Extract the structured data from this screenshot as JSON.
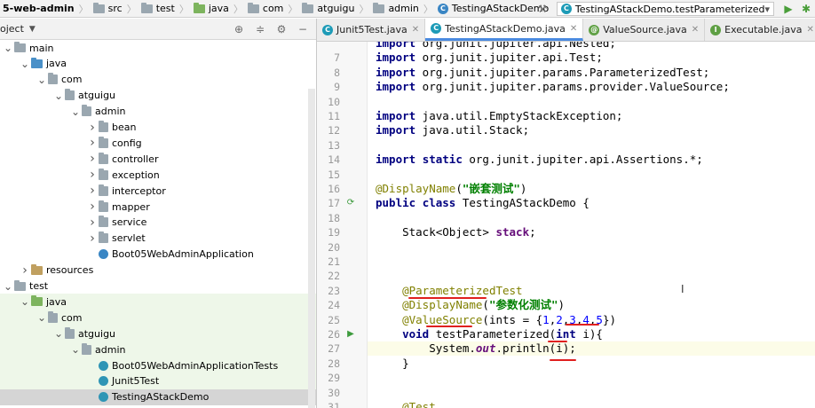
{
  "breadcrumb": {
    "items": [
      {
        "label": "5-web-admin",
        "icon": "module-icon",
        "bold": true
      },
      {
        "label": "src",
        "icon": "folder-icon"
      },
      {
        "label": "test",
        "icon": "folder-icon"
      },
      {
        "label": "java",
        "icon": "folder-icon"
      },
      {
        "label": "com",
        "icon": "package-icon"
      },
      {
        "label": "atguigu",
        "icon": "package-icon"
      },
      {
        "label": "admin",
        "icon": "package-icon"
      },
      {
        "label": "TestingAStackDemo",
        "icon": "class-icon"
      }
    ],
    "run_config": "TestingAStackDemo.testParameterized"
  },
  "project_panel": {
    "title": "oject",
    "tree": [
      {
        "label": "main",
        "indent": 0,
        "arrow": "down",
        "icon": "folder-grey"
      },
      {
        "label": "java",
        "indent": 1,
        "arrow": "down",
        "icon": "folder-blue"
      },
      {
        "label": "com",
        "indent": 2,
        "arrow": "down",
        "icon": "package-grey"
      },
      {
        "label": "atguigu",
        "indent": 3,
        "arrow": "down",
        "icon": "package-grey"
      },
      {
        "label": "admin",
        "indent": 4,
        "arrow": "down",
        "icon": "package-grey"
      },
      {
        "label": "bean",
        "indent": 5,
        "arrow": "right",
        "icon": "package-grey"
      },
      {
        "label": "config",
        "indent": 5,
        "arrow": "right",
        "icon": "package-grey"
      },
      {
        "label": "controller",
        "indent": 5,
        "arrow": "right",
        "icon": "package-grey"
      },
      {
        "label": "exception",
        "indent": 5,
        "arrow": "right",
        "icon": "package-grey"
      },
      {
        "label": "interceptor",
        "indent": 5,
        "arrow": "right",
        "icon": "package-grey"
      },
      {
        "label": "mapper",
        "indent": 5,
        "arrow": "right",
        "icon": "package-grey"
      },
      {
        "label": "service",
        "indent": 5,
        "arrow": "right",
        "icon": "package-grey"
      },
      {
        "label": "servlet",
        "indent": 5,
        "arrow": "right",
        "icon": "package-grey"
      },
      {
        "label": "Boot05WebAdminApplication",
        "indent": 5,
        "arrow": "none",
        "icon": "spring-class"
      },
      {
        "label": "resources",
        "indent": 1,
        "arrow": "right",
        "icon": "resources-folder"
      },
      {
        "label": "test",
        "indent": 0,
        "arrow": "down",
        "icon": "folder-grey"
      },
      {
        "label": "java",
        "indent": 1,
        "arrow": "down",
        "icon": "folder-green"
      },
      {
        "label": "com",
        "indent": 2,
        "arrow": "down",
        "icon": "package-grey"
      },
      {
        "label": "atguigu",
        "indent": 3,
        "arrow": "down",
        "icon": "package-grey"
      },
      {
        "label": "admin",
        "indent": 4,
        "arrow": "down",
        "icon": "package-grey"
      },
      {
        "label": "Boot05WebAdminApplicationTests",
        "indent": 5,
        "arrow": "none",
        "icon": "test-class"
      },
      {
        "label": "Junit5Test",
        "indent": 5,
        "arrow": "none",
        "icon": "test-class"
      },
      {
        "label": "TestingAStackDemo",
        "indent": 5,
        "arrow": "none",
        "icon": "test-class"
      }
    ]
  },
  "tabs": [
    {
      "label": "Junit5Test.java",
      "icon": "test-class-icon",
      "active": false
    },
    {
      "label": "TestingAStackDemo.java",
      "icon": "test-class-icon",
      "active": true
    },
    {
      "label": "ValueSource.java",
      "icon": "annotation-icon",
      "active": false
    },
    {
      "label": "Executable.java",
      "icon": "interface-icon",
      "active": false
    }
  ],
  "editor": {
    "lines": [
      {
        "n": "",
        "code": "import org.junit.jupiter.api.Nested;"
      },
      {
        "n": "7",
        "code": "import org.junit.jupiter.api.Test;"
      },
      {
        "n": "8",
        "code": "import org.junit.jupiter.params.ParameterizedTest;"
      },
      {
        "n": "9",
        "code": "import org.junit.jupiter.params.provider.ValueSource;"
      },
      {
        "n": "10",
        "code": ""
      },
      {
        "n": "11",
        "code": "import java.util.EmptyStackException;"
      },
      {
        "n": "12",
        "code": "import java.util.Stack;"
      },
      {
        "n": "13",
        "code": ""
      },
      {
        "n": "14",
        "code": "import static org.junit.jupiter.api.Assertions.*;"
      },
      {
        "n": "15",
        "code": ""
      },
      {
        "n": "16",
        "code": "@DisplayName(\"嵌套测试\")"
      },
      {
        "n": "17",
        "code": "public class TestingAStackDemo {"
      },
      {
        "n": "18",
        "code": ""
      },
      {
        "n": "19",
        "code": "    Stack<Object> stack;"
      },
      {
        "n": "20",
        "code": ""
      },
      {
        "n": "21",
        "code": ""
      },
      {
        "n": "22",
        "code": ""
      },
      {
        "n": "23",
        "code": "    @ParameterizedTest"
      },
      {
        "n": "24",
        "code": "    @DisplayName(\"参数化测试\")"
      },
      {
        "n": "25",
        "code": "    @ValueSource(ints = {1,2,3,4,5})"
      },
      {
        "n": "26",
        "code": "    void testParameterized(int i){"
      },
      {
        "n": "27",
        "code": "        System.out.println(i);"
      },
      {
        "n": "28",
        "code": "    }"
      },
      {
        "n": "29",
        "code": ""
      },
      {
        "n": "30",
        "code": ""
      },
      {
        "n": "31",
        "code": "    @Test"
      }
    ]
  },
  "colors": {
    "keyword": "#000080",
    "annotation": "#808000",
    "string": "#008000",
    "number": "#0000ff",
    "field": "#660e7a",
    "pen": "#e0201f"
  }
}
